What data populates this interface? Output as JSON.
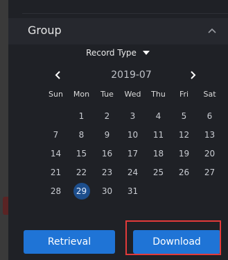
{
  "top_label": "popup",
  "group": {
    "title": "Group",
    "icon": "chevron-up-icon"
  },
  "record_type": {
    "label": "Record Type",
    "icon": "caret-down-icon"
  },
  "calendar": {
    "month": "2019-07",
    "prev_icon": "chevron-left-icon",
    "next_icon": "chevron-right-icon",
    "weekdays": [
      "Sun",
      "Mon",
      "Tue",
      "Wed",
      "Thu",
      "Fri",
      "Sat"
    ],
    "weeks": [
      [
        "",
        "1",
        "2",
        "3",
        "4",
        "5",
        "6"
      ],
      [
        "7",
        "8",
        "9",
        "10",
        "11",
        "12",
        "13"
      ],
      [
        "14",
        "15",
        "16",
        "17",
        "18",
        "19",
        "20"
      ],
      [
        "21",
        "22",
        "23",
        "24",
        "25",
        "26",
        "27"
      ],
      [
        "28",
        "29",
        "30",
        "31",
        "",
        "",
        ""
      ]
    ],
    "selected_day": "29"
  },
  "buttons": {
    "retrieval": "Retrieval",
    "download": "Download"
  },
  "colors": {
    "panel_bg": "#1f2126",
    "accent_button": "#1f74d6",
    "selected_day": "#1d4e8c",
    "highlight": "#e23a3a"
  }
}
